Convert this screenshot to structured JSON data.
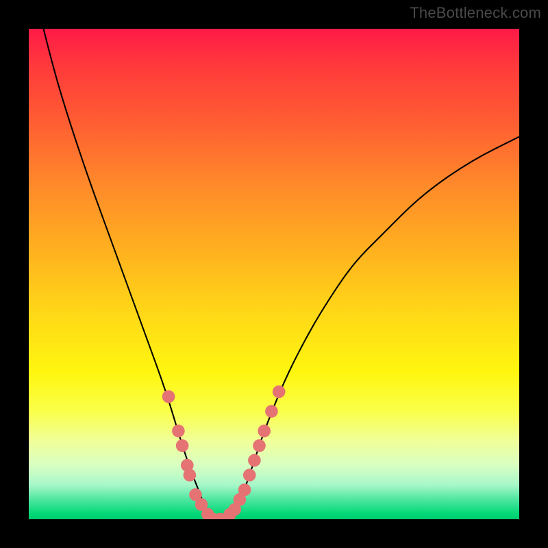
{
  "source_label": "TheBottleneck.com",
  "chart_data": {
    "type": "line",
    "title": "",
    "xlabel": "",
    "ylabel": "",
    "xlim": [
      0,
      100
    ],
    "ylim": [
      0,
      100
    ],
    "series": [
      {
        "name": "bottleneck-curve",
        "x": [
          3,
          5,
          8,
          12,
          16,
          20,
          24,
          28,
          31,
          33,
          35,
          36,
          37,
          38,
          40,
          42,
          44,
          46,
          48,
          52,
          56,
          60,
          66,
          72,
          80,
          90,
          100
        ],
        "y": [
          100,
          92,
          82,
          70,
          59,
          48,
          37,
          26,
          16,
          10,
          5,
          2,
          0,
          0,
          0,
          2,
          6,
          12,
          18,
          28,
          36,
          43,
          52,
          58,
          66,
          73,
          78
        ]
      }
    ],
    "markers": [
      {
        "x": 28.5,
        "y": 25
      },
      {
        "x": 30.5,
        "y": 18
      },
      {
        "x": 31.3,
        "y": 15
      },
      {
        "x": 32.3,
        "y": 11
      },
      {
        "x": 32.8,
        "y": 9
      },
      {
        "x": 34.0,
        "y": 5
      },
      {
        "x": 35.2,
        "y": 3
      },
      {
        "x": 36.5,
        "y": 1
      },
      {
        "x": 37.6,
        "y": 0
      },
      {
        "x": 39.0,
        "y": 0
      },
      {
        "x": 40.2,
        "y": 0
      },
      {
        "x": 41.0,
        "y": 1
      },
      {
        "x": 42.0,
        "y": 2
      },
      {
        "x": 43.0,
        "y": 4
      },
      {
        "x": 44.0,
        "y": 6
      },
      {
        "x": 45.0,
        "y": 9
      },
      {
        "x": 46.0,
        "y": 12
      },
      {
        "x": 47.0,
        "y": 15
      },
      {
        "x": 48.0,
        "y": 18
      },
      {
        "x": 49.5,
        "y": 22
      },
      {
        "x": 51.0,
        "y": 26
      }
    ],
    "marker_radius_pct": 1.3,
    "colors": {
      "curve": "#000000",
      "markers": "#e57373",
      "frame": "#000000"
    }
  }
}
